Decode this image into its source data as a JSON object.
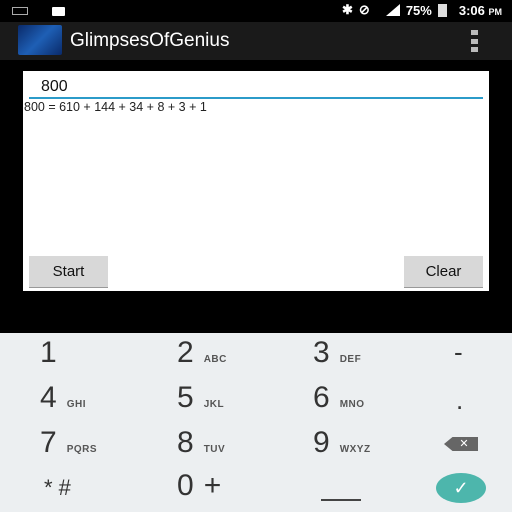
{
  "status_bar": {
    "battery": "75%",
    "time": "3:06",
    "time_suffix": "PM",
    "icons": [
      "keyboard-icon",
      "lock-icon",
      "bluetooth-icon",
      "do-not-disturb-icon",
      "signal-icon",
      "battery-icon"
    ]
  },
  "action_bar": {
    "title": "GlimpsesOfGenius",
    "menu_icon": "overflow-menu-icon"
  },
  "form": {
    "input_value": "800",
    "result": "800 = 610 + 144 + 34 + 8 + 3 + 1",
    "start_label": "Start",
    "clear_label": "Clear"
  },
  "keypad": {
    "keys": [
      {
        "num": "1",
        "letters": ""
      },
      {
        "num": "2",
        "letters": "ABC"
      },
      {
        "num": "3",
        "letters": "DEF"
      },
      {
        "num": "4",
        "letters": "GHI"
      },
      {
        "num": "5",
        "letters": "JKL"
      },
      {
        "num": "6",
        "letters": "MNO"
      },
      {
        "num": "7",
        "letters": "PQRS"
      },
      {
        "num": "8",
        "letters": "TUV"
      },
      {
        "num": "9",
        "letters": "WXYZ"
      },
      {
        "num": "0",
        "letters": "+"
      }
    ],
    "minus": "-",
    "dot": ".",
    "star_hash": "* #",
    "backspace": "✕",
    "done": "✓"
  }
}
